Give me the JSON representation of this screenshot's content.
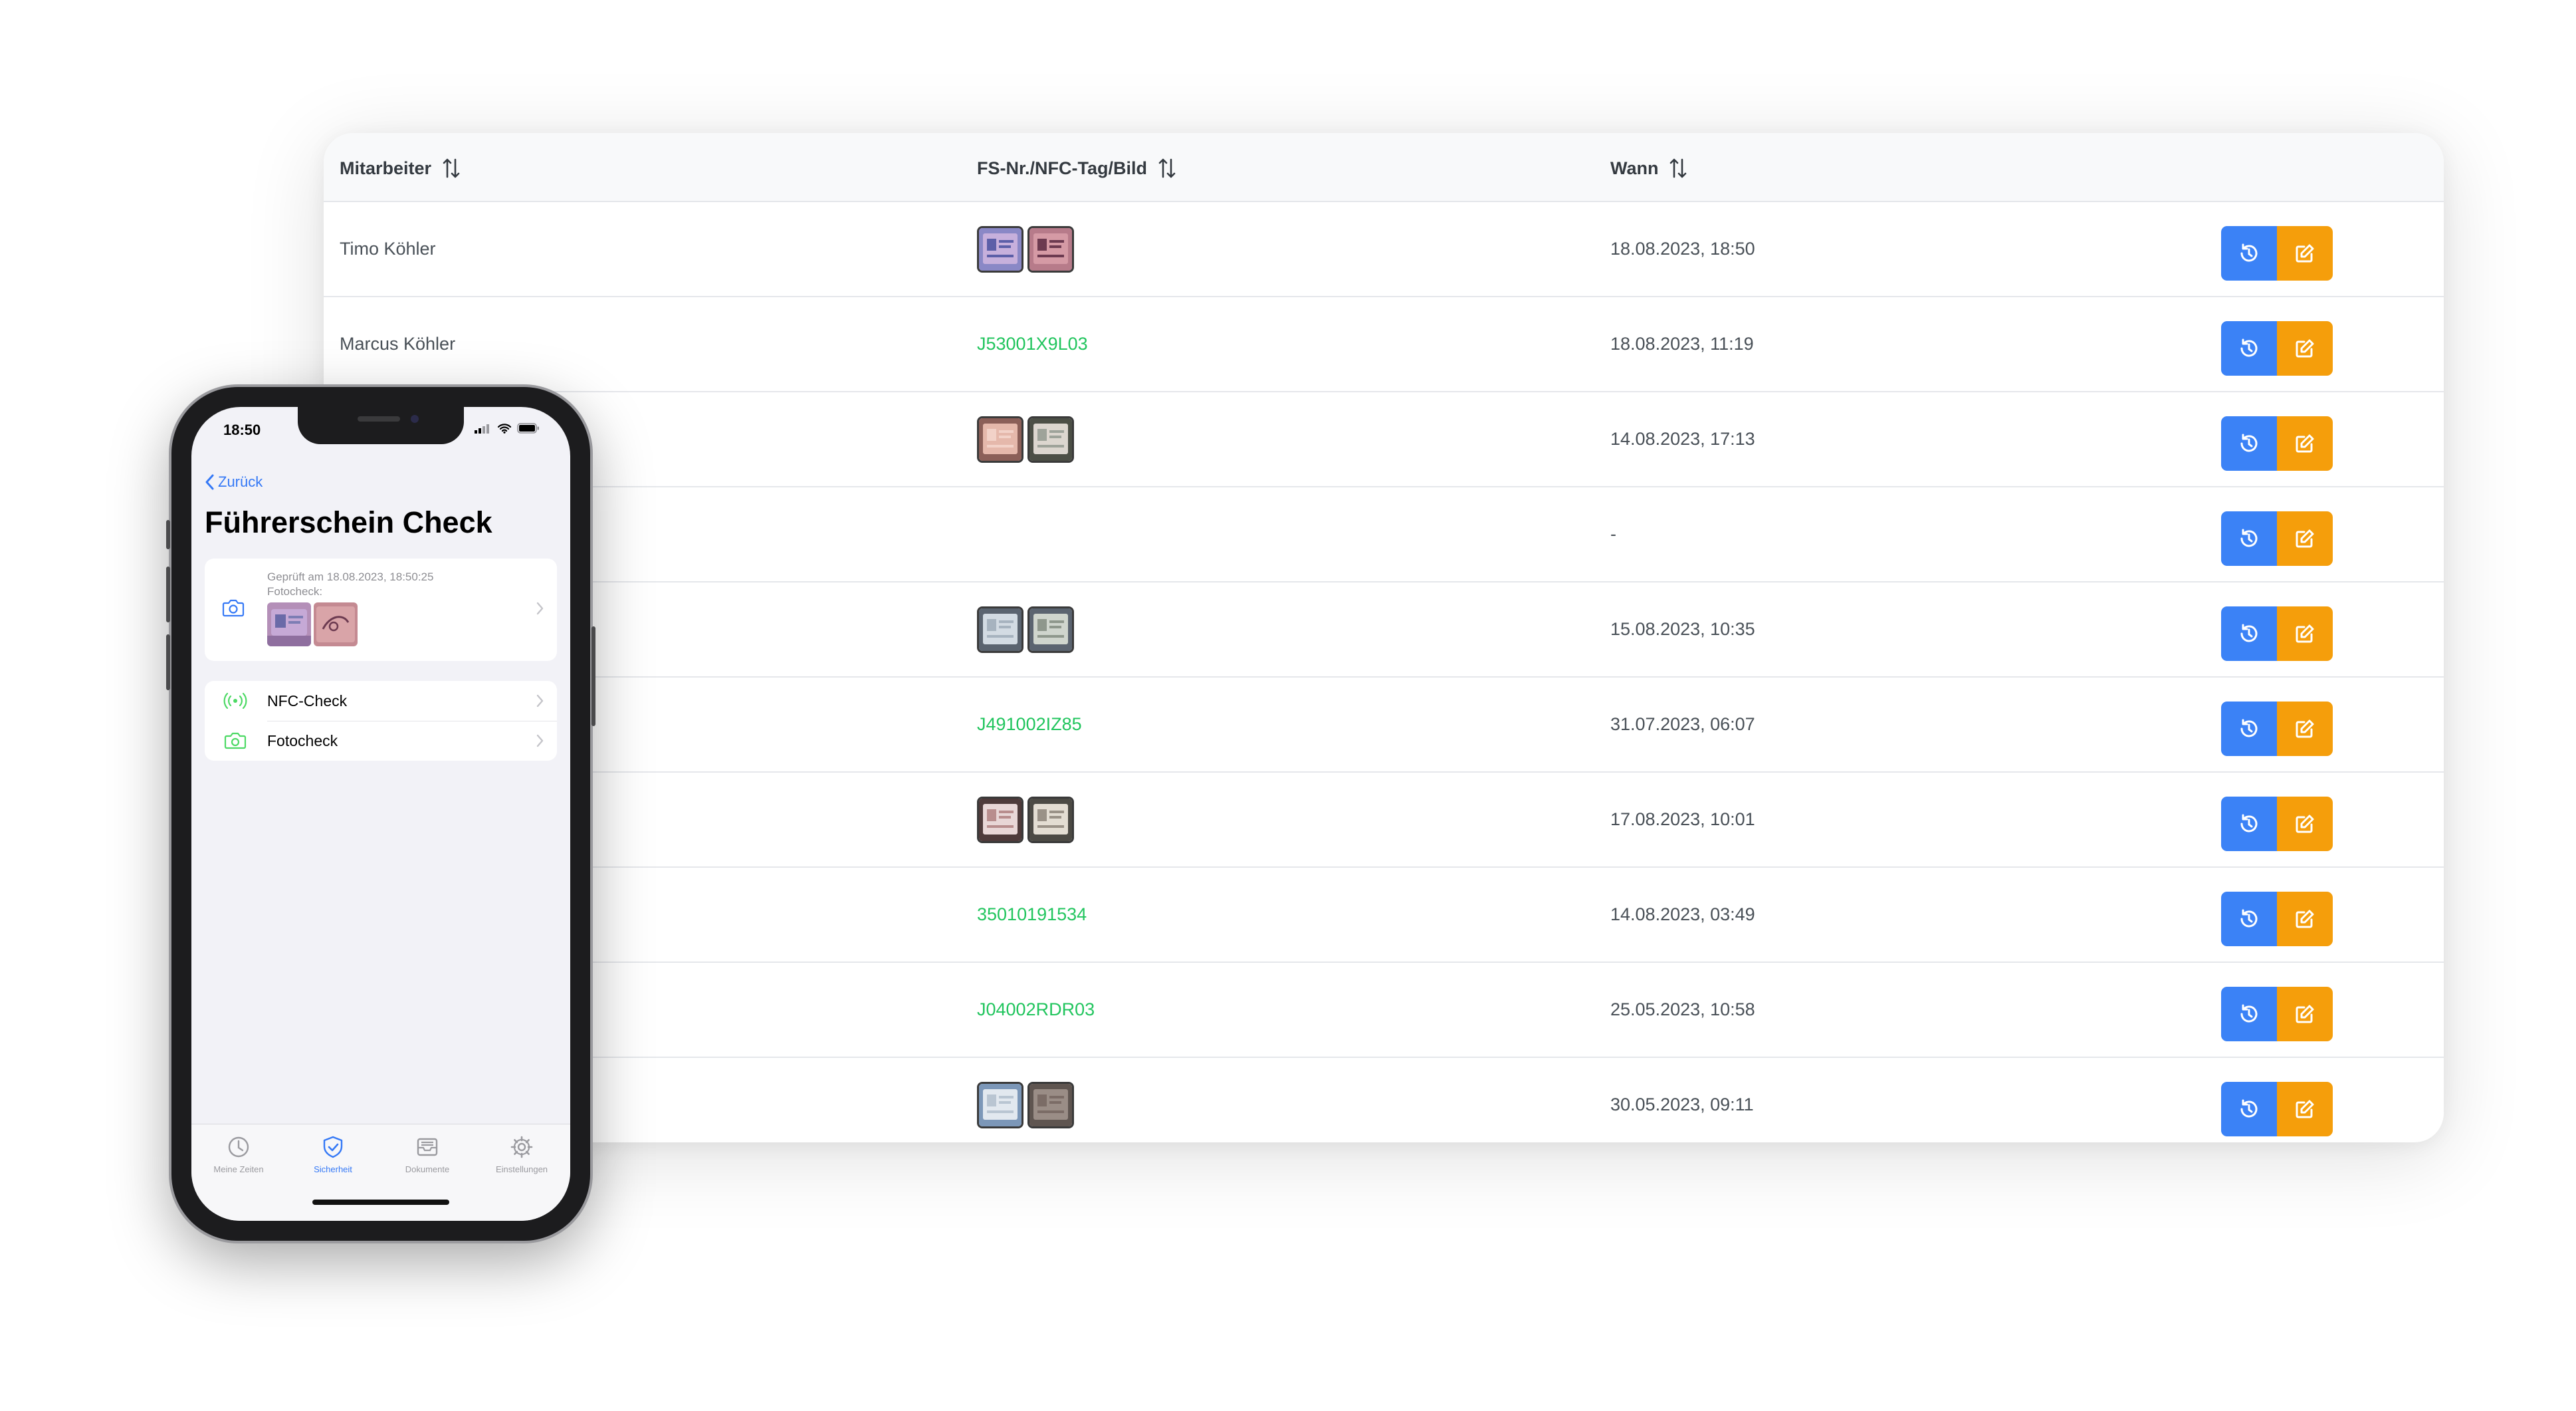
{
  "colors": {
    "accent_blue": "#3b82f6",
    "accent_orange": "#f59e0b",
    "link_green": "#22c55e",
    "ios_blue": "#3478f6"
  },
  "table": {
    "columns": [
      {
        "label": "Mitarbeiter",
        "icon": "sort-icon"
      },
      {
        "label": "FS-Nr./NFC-Tag/Bild",
        "icon": "sort-icon"
      },
      {
        "label": "Wann",
        "icon": "sort-icon"
      }
    ],
    "rows": [
      {
        "employee": "Timo Köhler",
        "id_type": "images",
        "id_value": "",
        "when": "18.08.2023, 18:50"
      },
      {
        "employee": "Marcus Köhler",
        "id_type": "text",
        "id_value": "J53001X9L03",
        "when": "18.08.2023, 11:19"
      },
      {
        "employee": "",
        "id_type": "images",
        "id_value": "",
        "when": "14.08.2023, 17:13"
      },
      {
        "employee": "",
        "id_type": "none",
        "id_value": "",
        "when": "-"
      },
      {
        "employee": "",
        "id_type": "images",
        "id_value": "",
        "when": "15.08.2023, 10:35"
      },
      {
        "employee": "",
        "id_type": "text",
        "id_value": "J491002IZ85",
        "when": "31.07.2023, 06:07"
      },
      {
        "employee": "",
        "id_type": "images",
        "id_value": "",
        "when": "17.08.2023, 10:01"
      },
      {
        "employee": "",
        "id_type": "text",
        "id_value": "35010191534",
        "when": "14.08.2023, 03:49"
      },
      {
        "employee": "",
        "id_type": "text",
        "id_value": "J04002RDR03",
        "when": "25.05.2023, 10:58"
      },
      {
        "employee": "",
        "id_type": "images",
        "id_value": "",
        "when": "30.05.2023, 09:11"
      }
    ],
    "row_actions": [
      {
        "icon": "history-icon"
      },
      {
        "icon": "edit-icon"
      }
    ]
  },
  "phone": {
    "status_time": "18:50",
    "back_label": "Zurück",
    "title": "Führerschein Check",
    "check_card": {
      "icon": "camera-icon",
      "line1": "Geprüft am 18.08.2023, 18:50:25",
      "line2": "Fotocheck:"
    },
    "menu": [
      {
        "label": "NFC-Check",
        "icon": "nfc-icon"
      },
      {
        "label": "Fotocheck",
        "icon": "camera-icon"
      }
    ],
    "tabs": [
      {
        "label": "Meine Zeiten",
        "icon": "clock-icon",
        "active": false
      },
      {
        "label": "Sicherheit",
        "icon": "shield-check-icon",
        "active": true
      },
      {
        "label": "Dokumente",
        "icon": "tray-icon",
        "active": false
      },
      {
        "label": "Einstellungen",
        "icon": "gear-icon",
        "active": false
      }
    ]
  }
}
